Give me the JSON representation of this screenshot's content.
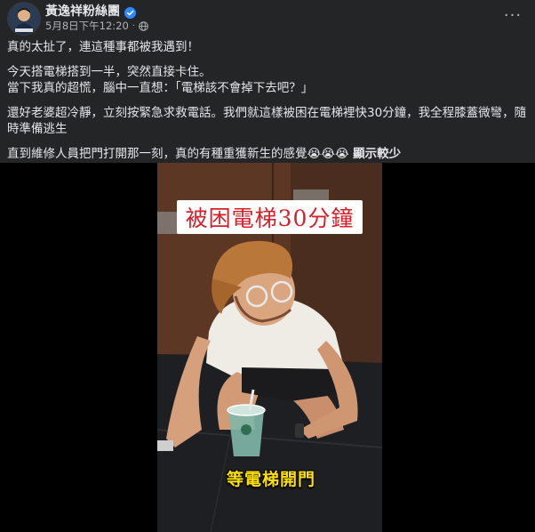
{
  "header": {
    "page_name": "黃逸祥粉絲團",
    "timestamp": "5月8日下午12:20",
    "separator": "·",
    "verified_icon": "verified-badge-icon",
    "privacy_icon": "globe-icon",
    "more_label": "···"
  },
  "post": {
    "paragraphs": [
      "真的太扯了，連這種事都被我遇到！",
      "今天搭電梯搭到一半，突然直接卡住。",
      "當下我真的超慌，腦中一直想：「電梯該不會掉下去吧？」",
      "還好老婆超冷靜，立刻按緊急求救電話。我們就這樣被困在電梯裡快30分鐘，我全程膝蓋微彎，隨時準備逃生",
      "直到維修人員把門打開那一刻，真的有種重獲新生的感覺😭😭😭"
    ],
    "see_more": "顯示較少"
  },
  "video": {
    "caption_top": "被困電梯30分鐘",
    "caption_bottom": "等電梯開門"
  },
  "colors": {
    "background": "#242526",
    "text": "#e4e6eb",
    "secondary_text": "#b0b3b8",
    "verified": "#2d88ff",
    "caption_red": "#d8202a",
    "caption_yellow": "#ffe100"
  }
}
